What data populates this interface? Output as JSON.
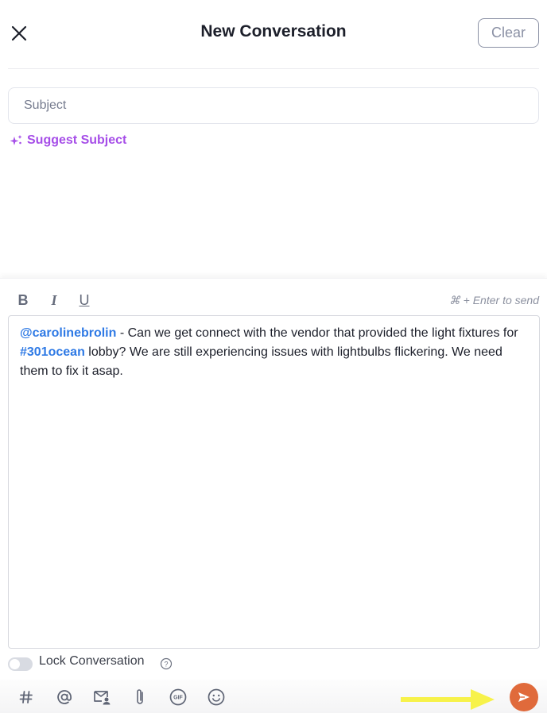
{
  "header": {
    "title": "New Conversation",
    "clear_label": "Clear",
    "close_icon": "close-icon"
  },
  "subject": {
    "value": "",
    "placeholder": "Subject"
  },
  "suggest": {
    "label": "Suggest Subject",
    "icon": "sparkles-icon",
    "color": "#a64ee8"
  },
  "composer": {
    "format_buttons": [
      {
        "label": "B",
        "icon": "bold-icon"
      },
      {
        "label": "I",
        "icon": "italic-icon"
      },
      {
        "label": "U",
        "icon": "underline-icon"
      }
    ],
    "send_hint": "⌘ + Enter to send",
    "message": {
      "mention_user": "@carolinebrolin",
      "text_1": " - Can we get connect with the vendor that provided the light fixtures for ",
      "mention_tag": "#301ocean",
      "text_2": " lobby?  We are still experiencing issues with lightbulbs flickering.  We need them to fix it asap."
    },
    "lock_label": "Lock Conversation",
    "lock_enabled": false,
    "toolbar_icons": [
      "hashtag-icon",
      "at-icon",
      "mail-contact-icon",
      "paperclip-icon",
      "gif-icon",
      "emoji-icon"
    ],
    "send_icon": "send-icon",
    "colors": {
      "mention": "#2f7ae5",
      "send_button": "#e06a3b",
      "annotation_arrow": "#f7f24a"
    }
  }
}
